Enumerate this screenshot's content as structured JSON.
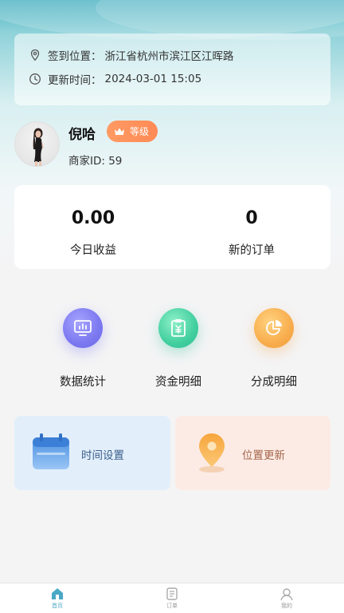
{
  "location_card": {
    "checkin_label": "签到位置：",
    "checkin_value": "浙江省杭州市滨江区江晖路",
    "update_label": "更新时间：",
    "update_value": "2024-03-01 15:05"
  },
  "profile": {
    "name": "倪哈",
    "level_badge": "等级",
    "merchant_id": "商家ID:  59"
  },
  "stats": [
    {
      "value": "0.00",
      "label": "今日收益"
    },
    {
      "value": "0",
      "label": "新的订单"
    }
  ],
  "features": [
    {
      "label": "数据统计",
      "icon": "monitor-chart-icon",
      "color": "#7f7cf3"
    },
    {
      "label": "资金明细",
      "icon": "clipboard-yen-icon",
      "color": "#38c79c"
    },
    {
      "label": "分成明细",
      "icon": "pie-chart-icon",
      "color": "#f6a74a"
    }
  ],
  "tiles": [
    {
      "label": "时间设置",
      "icon": "calendar-icon"
    },
    {
      "label": "位置更新",
      "icon": "map-pin-icon"
    }
  ],
  "tabbar": [
    {
      "label": "首页",
      "icon": "home-icon",
      "active": true
    },
    {
      "label": "订单",
      "icon": "order-icon",
      "active": false
    },
    {
      "label": "我的",
      "icon": "user-icon",
      "active": false
    }
  ],
  "colors": {
    "accent": "#4aa8c6",
    "badge": "#ff8f5a"
  }
}
